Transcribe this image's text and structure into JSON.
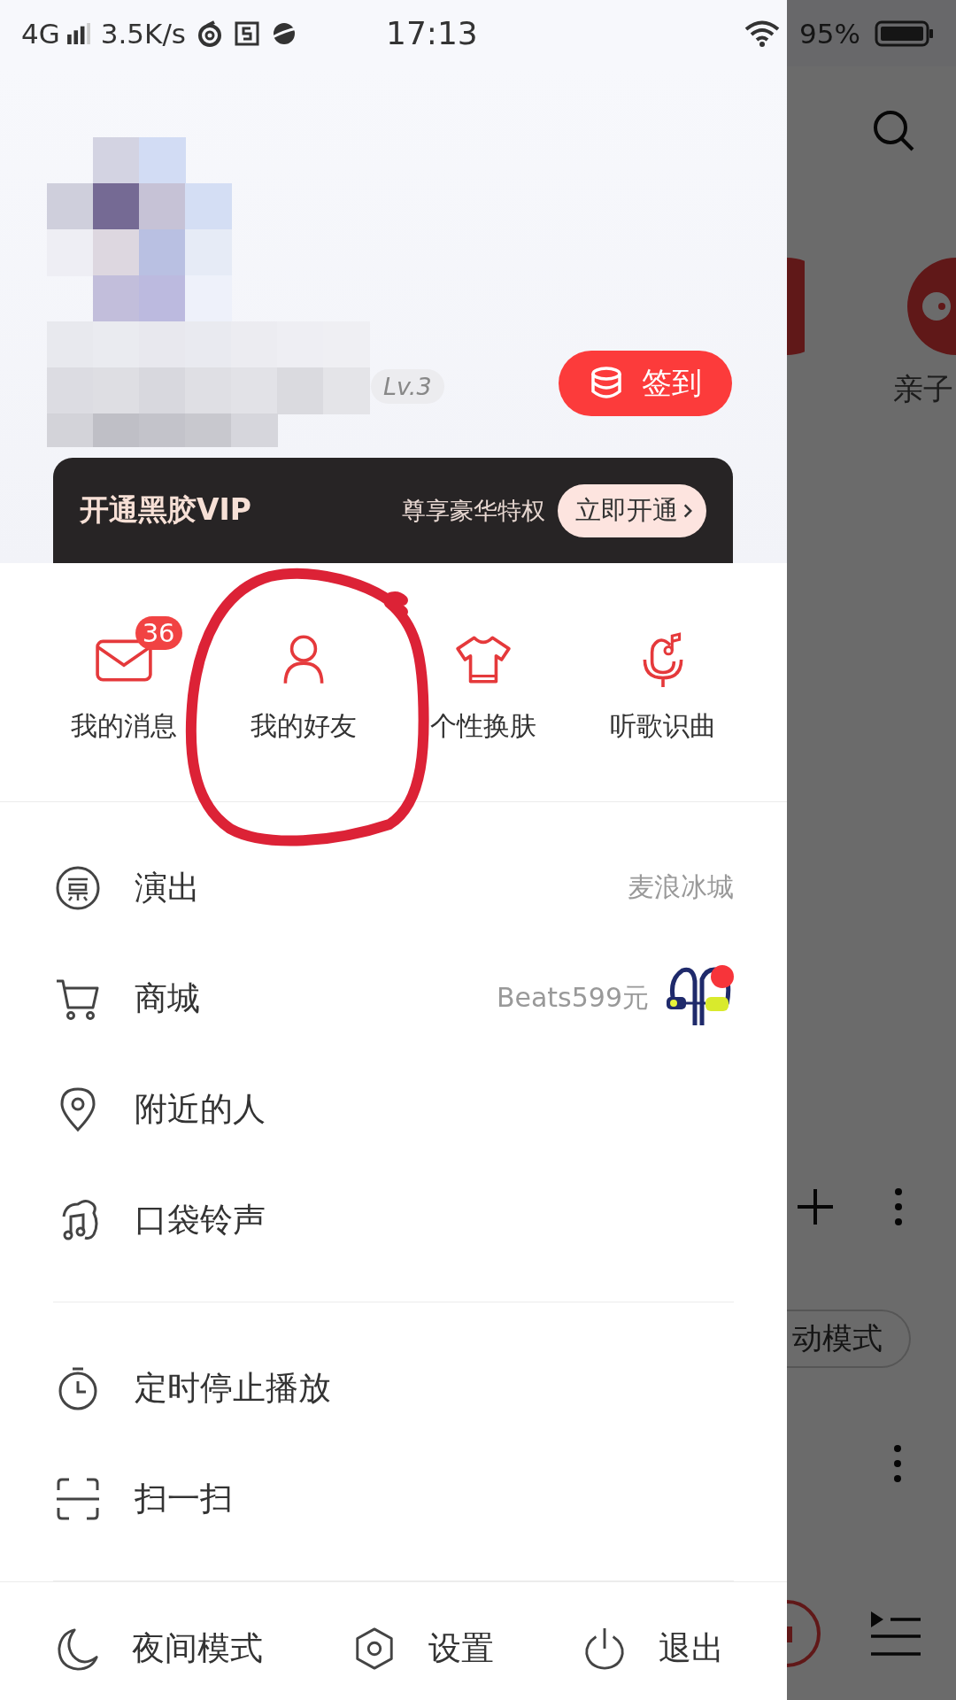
{
  "status_bar": {
    "network": "4G",
    "speed": "3.5K/s",
    "time": "17:13",
    "battery": "95%"
  },
  "profile": {
    "level": "Lv.3",
    "checkin_button": "签到"
  },
  "vip_banner": {
    "title": "开通黑胶VIP",
    "subtitle": "尊享豪华特权",
    "button": "立即开通"
  },
  "shortcuts": [
    {
      "label": "我的消息",
      "badge": "36"
    },
    {
      "label": "我的好友"
    },
    {
      "label": "个性换肤"
    },
    {
      "label": "听歌识曲"
    }
  ],
  "annotation_circle": true,
  "menu_sections": [
    {
      "items": [
        {
          "label": "演出",
          "detail": "麦浪冰城"
        },
        {
          "label": "商城",
          "detail": "Beats599元",
          "thumbnail": true,
          "dot": true
        },
        {
          "label": "附近的人"
        },
        {
          "label": "口袋铃声"
        }
      ]
    },
    {
      "items": [
        {
          "label": "定时停止播放"
        },
        {
          "label": "扫一扫"
        }
      ]
    }
  ],
  "bottom_bar": [
    {
      "label": "夜间模式"
    },
    {
      "label": "设置"
    },
    {
      "label": "退出"
    }
  ],
  "background_app": {
    "category_label": "亲子",
    "chip": "动模式"
  }
}
